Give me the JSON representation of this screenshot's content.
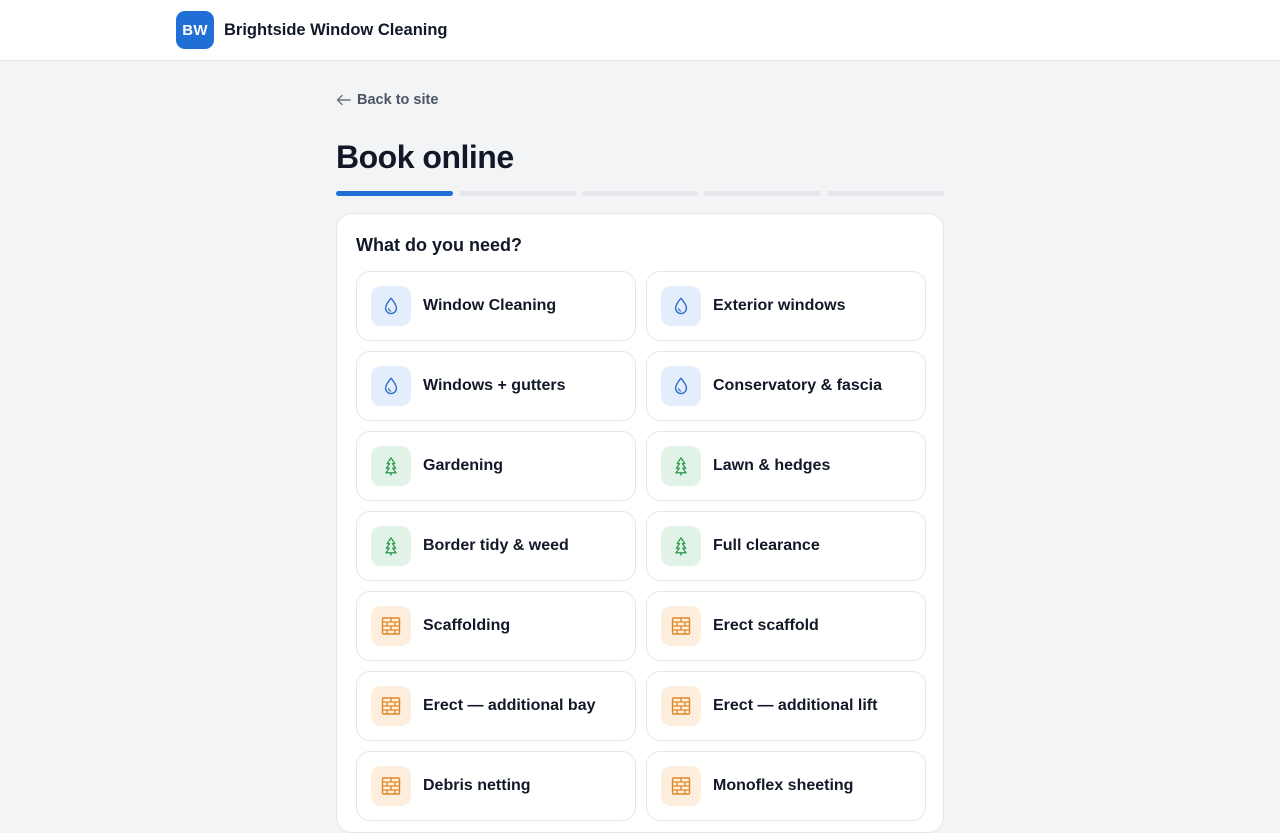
{
  "brand": {
    "initials": "BW",
    "name": "Brightside Window Cleaning"
  },
  "nav": {
    "back_label": "Back to site"
  },
  "page": {
    "title": "Book online"
  },
  "progress": {
    "total_steps": 5,
    "current_step": 1
  },
  "step": {
    "question": "What do you need?",
    "options": [
      {
        "label": "Window Cleaning",
        "icon": "water-drop-icon",
        "tone": "blue"
      },
      {
        "label": "Exterior windows",
        "icon": "water-drop-icon",
        "tone": "blue"
      },
      {
        "label": "Windows + gutters",
        "icon": "water-drop-icon",
        "tone": "blue"
      },
      {
        "label": "Conservatory & fascia",
        "icon": "water-drop-icon",
        "tone": "blue"
      },
      {
        "label": "Gardening",
        "icon": "tree-icon",
        "tone": "green"
      },
      {
        "label": "Lawn & hedges",
        "icon": "tree-icon",
        "tone": "green"
      },
      {
        "label": "Border tidy & weed",
        "icon": "tree-icon",
        "tone": "green"
      },
      {
        "label": "Full clearance",
        "icon": "tree-icon",
        "tone": "green"
      },
      {
        "label": "Scaffolding",
        "icon": "brick-wall-icon",
        "tone": "orange"
      },
      {
        "label": "Erect scaffold",
        "icon": "brick-wall-icon",
        "tone": "orange"
      },
      {
        "label": "Erect — additional bay",
        "icon": "brick-wall-icon",
        "tone": "orange"
      },
      {
        "label": "Erect — additional lift",
        "icon": "brick-wall-icon",
        "tone": "orange"
      },
      {
        "label": "Debris netting",
        "icon": "brick-wall-icon",
        "tone": "orange"
      },
      {
        "label": "Monoflex sheeting",
        "icon": "brick-wall-icon",
        "tone": "orange"
      }
    ]
  },
  "colors": {
    "accent": "#1f6fd6",
    "water_tone_bg": "#e3edfb",
    "garden_tone_bg": "#e1f3e6",
    "scaffold_tone_bg": "#fdeedd"
  }
}
